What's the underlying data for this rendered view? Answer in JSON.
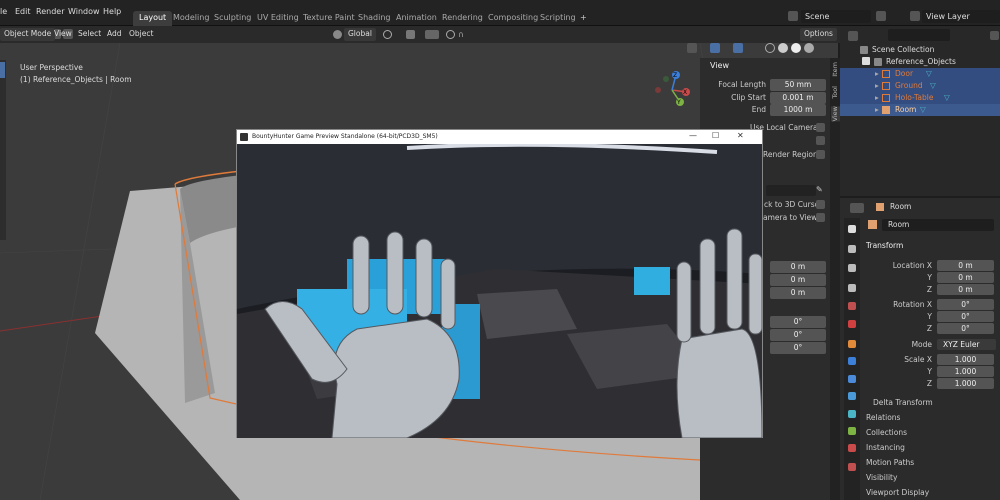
{
  "menu": [
    "le",
    "Edit",
    "Render",
    "Window",
    "Help"
  ],
  "workspaces": [
    "Layout",
    "Modeling",
    "Sculpting",
    "UV Editing",
    "Texture Paint",
    "Shading",
    "Animation",
    "Rendering",
    "Compositing",
    "Scripting"
  ],
  "add_tab": "+",
  "scene": {
    "label": "Scene",
    "view_layer": "View Layer"
  },
  "header": {
    "mode": "Object Mode",
    "view": "View",
    "select": "Select",
    "add": "Add",
    "object": "Object",
    "orientation": "Global",
    "options": "Options"
  },
  "viewport": {
    "perspective": "User Perspective",
    "collection": "(1) Reference_Objects | Room"
  },
  "npanel": {
    "title": "View",
    "focal_length_label": "Focal Length",
    "focal_length": "50 mm",
    "clip_start_label": "Clip Start",
    "clip_start": "0.001 m",
    "end_label": "End",
    "end": "1000 m",
    "local_camera": "Use Local Camera",
    "render_region": "Render Region",
    "lock_cursor": "ck to 3D Cursor",
    "camera_view": "amera to View",
    "loc_values": [
      "0 m",
      "0 m",
      "0 m"
    ],
    "rot_values": [
      "0°",
      "0°",
      "0°"
    ],
    "tabs": [
      "Item",
      "Tool",
      "View"
    ]
  },
  "game": {
    "title": "BountyHunter Game Preview Standalone (64-bit/PCD3D_SM5)",
    "minimize": "—",
    "maximize": "☐",
    "close": "✕"
  },
  "outliner": {
    "scene_collection": "Scene Collection",
    "collection": "Reference_Objects",
    "items": [
      {
        "label": "Door",
        "color": "#e07a3a"
      },
      {
        "label": "Ground",
        "color": "#e07a3a"
      },
      {
        "label": "Holo-Table",
        "color": "#e07a3a"
      },
      {
        "label": "Room",
        "color": "#e0a070"
      }
    ]
  },
  "properties": {
    "object_name": "Room",
    "object_field": "Room",
    "transform": "Transform",
    "location_x_label": "Location X",
    "y_label": "Y",
    "z_label": "Z",
    "rotation_x_label": "Rotation X",
    "mode_label": "Mode",
    "mode": "XYZ Euler",
    "scale_x_label": "Scale X",
    "location": [
      "0 m",
      "0 m",
      "0 m"
    ],
    "rotation": [
      "0°",
      "0°",
      "0°"
    ],
    "scale": [
      "1.000",
      "1.000",
      "1.000"
    ],
    "delta": "Delta Transform",
    "sections": [
      "Relations",
      "Collections",
      "Instancing",
      "Motion Paths",
      "Visibility",
      "Viewport Display"
    ]
  },
  "gizmo": {
    "x": "X",
    "y": "Y",
    "z": "Z"
  },
  "colors": {
    "accent": "#e07a3a",
    "selection": "#334d80",
    "teal": "#4ab5c4"
  }
}
